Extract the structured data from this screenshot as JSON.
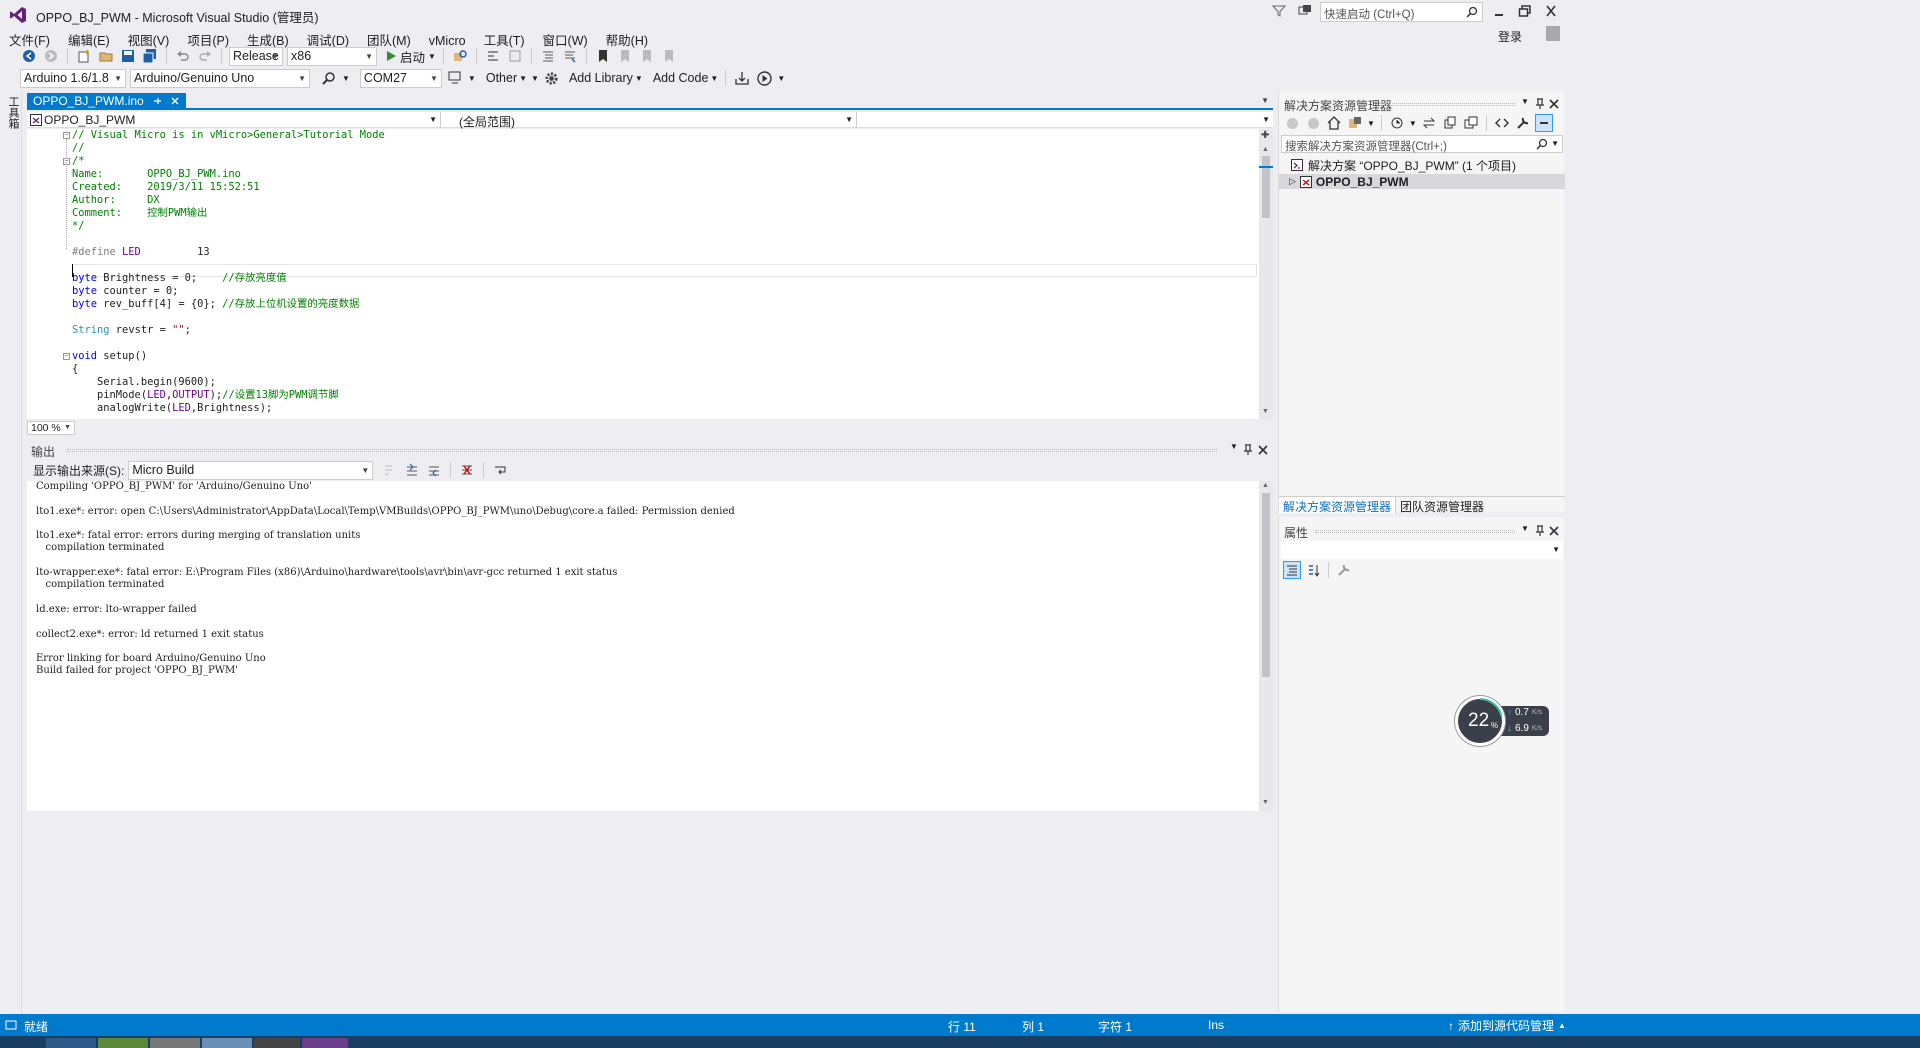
{
  "window": {
    "title": "OPPO_BJ_PWM - Microsoft Visual Studio (管理员)",
    "quick_launch_placeholder": "快速启动 (Ctrl+Q)",
    "login": "登录"
  },
  "menu": [
    "文件(F)",
    "编辑(E)",
    "视图(V)",
    "项目(P)",
    "生成(B)",
    "调试(D)",
    "团队(M)",
    "vMicro",
    "工具(T)",
    "窗口(W)",
    "帮助(H)"
  ],
  "toolbar": {
    "config": "Release",
    "platform": "x86",
    "start": "启动"
  },
  "vmicro_toolbar": {
    "ide": "Arduino 1.6/1.8",
    "board": "Arduino/Genuino Uno",
    "port": "COM27",
    "other": "Other",
    "add_library": "Add Library",
    "add_code": "Add Code"
  },
  "left_strip": "工具箱",
  "editor": {
    "tab": "OPPO_BJ_PWM.ino",
    "nav_file": "OPPO_BJ_PWM",
    "nav_scope": "(全局范围)",
    "zoom": "100 %",
    "lines": [
      [
        [
          "c-cm",
          "// Visual Micro is in vMicro>General>Tutorial Mode"
        ]
      ],
      [
        [
          "c-cm",
          "//"
        ]
      ],
      [
        [
          "c-cm",
          "/*"
        ]
      ],
      [
        [
          "c-cm",
          "Name:       OPPO_BJ_PWM.ino"
        ]
      ],
      [
        [
          "c-cm",
          "Created:    2019/3/11 15:52:51"
        ]
      ],
      [
        [
          "c-cm",
          "Author:     DX"
        ]
      ],
      [
        [
          "c-cm",
          "Comment:    控制PWM输出"
        ]
      ],
      [
        [
          "c-cm",
          "*/"
        ]
      ],
      [],
      [
        [
          "c-pp",
          "#define "
        ],
        [
          "c-mac",
          "LED"
        ],
        [
          "",
          "         13"
        ]
      ],
      [],
      [
        [
          "c-kw",
          "byte"
        ],
        [
          "",
          " Brightness = 0;    "
        ],
        [
          "c-cm",
          "//存放亮度值"
        ]
      ],
      [
        [
          "c-kw",
          "byte"
        ],
        [
          "",
          " counter = 0;"
        ]
      ],
      [
        [
          "c-kw",
          "byte"
        ],
        [
          "",
          " rev_buff[4] = {0}; "
        ],
        [
          "c-cm",
          "//存放上位机设置的亮度数据"
        ]
      ],
      [],
      [
        [
          "c-ty",
          "String"
        ],
        [
          "",
          " revstr = "
        ],
        [
          "c-st",
          "\"\""
        ],
        [
          "",
          ";"
        ]
      ],
      [],
      [
        [
          "c-kw",
          "void"
        ],
        [
          "",
          " setup()"
        ]
      ],
      [
        [
          "",
          "{"
        ]
      ],
      [
        [
          "",
          "    Serial.begin(9600);"
        ]
      ],
      [
        [
          "",
          "    pinMode("
        ],
        [
          "c-mac",
          "LED"
        ],
        [
          "",
          ","
        ],
        [
          "c-mac",
          "OUTPUT"
        ],
        [
          "",
          ");"
        ],
        [
          "c-cm",
          "//设置13脚为PWM调节脚"
        ]
      ],
      [
        [
          "",
          "    analogWrite("
        ],
        [
          "c-mac",
          "LED"
        ],
        [
          "",
          ",Brightness);"
        ]
      ]
    ]
  },
  "output": {
    "title": "输出",
    "source_label": "显示输出来源(S):",
    "source": "Micro Build",
    "lines": [
      "Compiling 'OPPO_BJ_PWM' for 'Arduino/Genuino Uno'",
      "",
      "lto1.exe*: error: open C:\\Users\\Administrator\\AppData\\Local\\Temp\\VMBuilds\\OPPO_BJ_PWM\\uno\\Debug\\core.a failed: Permission denied",
      "",
      "lto1.exe*: fatal error: errors during merging of translation units",
      "   compilation terminated",
      "",
      "lto-wrapper.exe*: fatal error: E:\\Program Files (x86)\\Arduino\\hardware\\tools\\avr\\bin\\avr-gcc returned 1 exit status",
      "   compilation terminated",
      "",
      "ld.exe: error: lto-wrapper failed",
      "",
      "collect2.exe*: error: ld returned 1 exit status",
      "",
      "Error linking for board Arduino/Genuino Uno",
      "Build failed for project 'OPPO_BJ_PWM'"
    ]
  },
  "solution_explorer": {
    "title": "解决方案资源管理器",
    "search_placeholder": "搜索解决方案资源管理器(Ctrl+;)",
    "solution": "解决方案 “OPPO_BJ_PWM” (1 个项目)",
    "project": "OPPO_BJ_PWM",
    "tab1": "解决方案资源管理器",
    "tab2": "团队资源管理器"
  },
  "properties": {
    "title": "属性"
  },
  "net_widget": {
    "cpu": "22",
    "unit": "%",
    "up": "0.7",
    "down": "6.9",
    "rate_unit": "K/s"
  },
  "status": {
    "ready": "就绪",
    "line": "行 11",
    "col": "列 1",
    "char": "字符 1",
    "ins": "Ins",
    "source_control": "添加到源代码管理"
  },
  "colors": {
    "accent": "#007acc",
    "vs_purple": "#68217a",
    "bg": "#eeeef2"
  }
}
